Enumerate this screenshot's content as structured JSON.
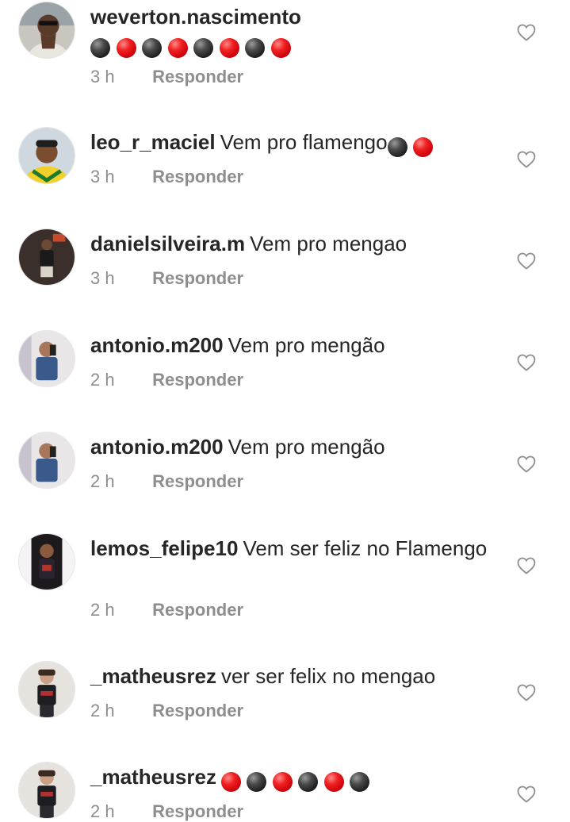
{
  "comments": [
    {
      "username": "weverton.nascimento",
      "text": "",
      "emoji": [
        "black",
        "red",
        "black",
        "red",
        "black",
        "red",
        "black",
        "red"
      ],
      "emoji_on_new_line": true,
      "time": "3 h",
      "reply_label": "Responder"
    },
    {
      "username": "leo_r_maciel",
      "text": "Vem pro flamengo",
      "emoji": [
        "black",
        "red"
      ],
      "emoji_on_new_line": false,
      "time": "3 h",
      "reply_label": "Responder"
    },
    {
      "username": "danielsilveira.m",
      "text": "Vem pro mengao",
      "emoji": [],
      "emoji_on_new_line": false,
      "time": "3 h",
      "reply_label": "Responder"
    },
    {
      "username": "antonio.m200",
      "text": "Vem pro mengão",
      "emoji": [],
      "emoji_on_new_line": false,
      "time": "2 h",
      "reply_label": "Responder"
    },
    {
      "username": "antonio.m200",
      "text": "Vem pro mengão",
      "emoji": [],
      "emoji_on_new_line": false,
      "time": "2 h",
      "reply_label": "Responder"
    },
    {
      "username": "lemos_felipe10",
      "text": "Vem ser feliz no Flamengo",
      "emoji": [],
      "emoji_on_new_line": false,
      "time": "2 h",
      "reply_label": "Responder"
    },
    {
      "username": "_matheusrez",
      "text": "ver ser felix no mengao",
      "emoji": [],
      "emoji_on_new_line": false,
      "time": "2 h",
      "reply_label": "Responder"
    },
    {
      "username": "_matheusrez",
      "text": "",
      "emoji": [
        "red",
        "black",
        "red",
        "black",
        "red",
        "black"
      ],
      "emoji_on_new_line": false,
      "time": "2 h",
      "reply_label": "Responder"
    }
  ],
  "icons": {
    "like": "heart-outline-icon",
    "avatar": "avatar"
  },
  "colors": {
    "text": "#262626",
    "secondary_text": "#8e8e8e",
    "emoji_black": "#1c1c1c",
    "emoji_red": "#e8121c"
  }
}
